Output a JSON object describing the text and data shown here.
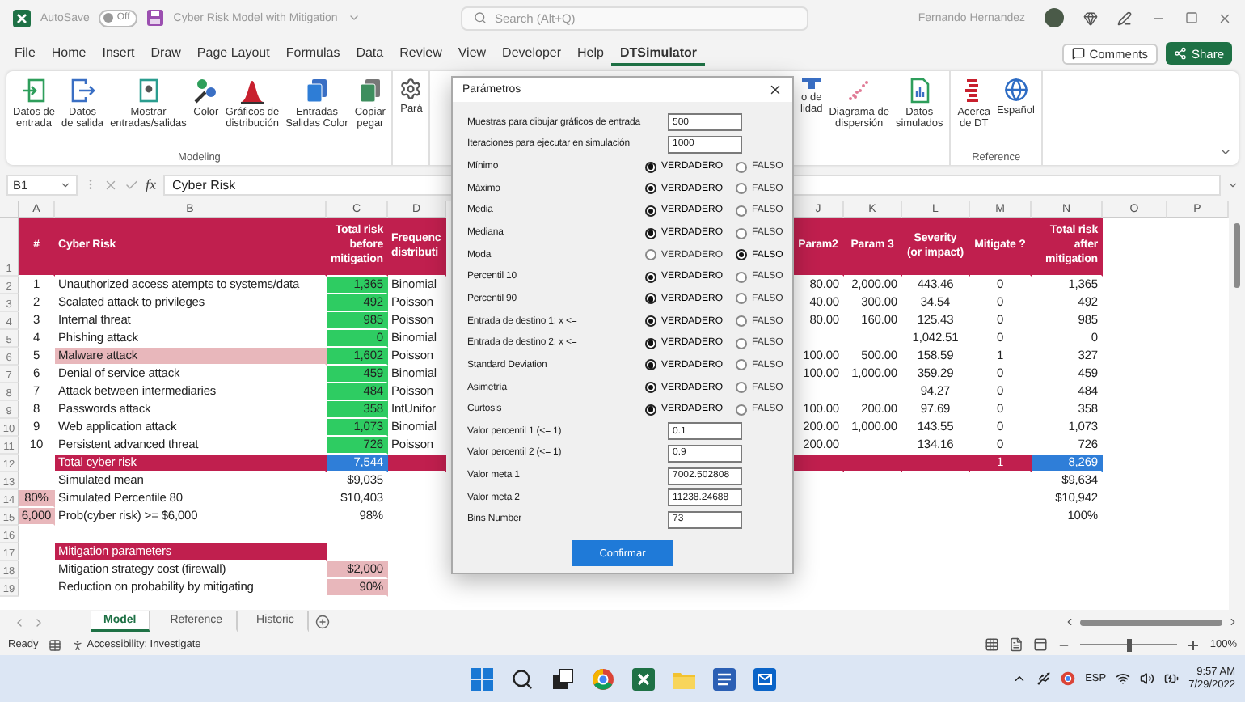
{
  "title_bar": {
    "autosave_label": "AutoSave",
    "autosave": {
      "on": false,
      "state_label": "Off"
    },
    "document_title": "Cyber Risk Model with Mitigation",
    "search": {
      "placeholder": "Search (Alt+Q)"
    },
    "user_name": "Fernando Hernandez"
  },
  "menu": {
    "tabs": [
      {
        "label": "File",
        "selected": false
      },
      {
        "label": "Home",
        "selected": false
      },
      {
        "label": "Insert",
        "selected": false
      },
      {
        "label": "Draw",
        "selected": false
      },
      {
        "label": "Page Layout",
        "selected": false
      },
      {
        "label": "Formulas",
        "selected": false
      },
      {
        "label": "Data",
        "selected": false
      },
      {
        "label": "Review",
        "selected": false
      },
      {
        "label": "View",
        "selected": false
      },
      {
        "label": "Developer",
        "selected": false
      },
      {
        "label": "Help",
        "selected": false
      },
      {
        "label": "DTSimulator",
        "selected": true
      }
    ],
    "comments_label": "Comments",
    "share_label": "Share"
  },
  "ribbon": {
    "left_groups": [
      {
        "label": "Modeling",
        "items": [
          "Datos de\nentrada",
          "Datos\nde salida",
          "Mostrar\nentradas/salidas",
          "Color",
          "Gráficos de\ndistribución",
          "Entradas\nSalidas Color",
          "Copiar\npegar"
        ]
      },
      {
        "items": [
          "Pará"
        ]
      }
    ],
    "right_groups": [
      {
        "items": [
          "o de\nlidad",
          "Diagrama de\ndispersión",
          "Datos\nsimulados"
        ]
      },
      {
        "label": "Reference",
        "items": [
          "Acerca\nde DT",
          "Español"
        ]
      }
    ]
  },
  "formula_bar": {
    "name_box": "B1",
    "function_label": "fx",
    "content": "Cyber Risk"
  },
  "sheet": {
    "left_columns": [
      "A",
      "B",
      "C",
      "D"
    ],
    "right_columns": [
      "J",
      "K",
      "L",
      "M",
      "N",
      "O",
      "P"
    ],
    "rows": [
      {
        "number": "1",
        "kind": "header",
        "cells": {
          "A": {
            "text": "#",
            "color": "#c01f4e"
          },
          "B": {
            "text": "Cyber Risk",
            "color": "#c01f4e"
          },
          "C": {
            "text": "Total risk before mitigation",
            "color": "#c01f4e"
          },
          "D": {
            "text": "Frequenc distributi",
            "color": "#c01f4e"
          },
          "J": {
            "text": "Param2",
            "color": "#c01f4e"
          },
          "K": {
            "text": "Param 3",
            "color": "#c01f4e"
          },
          "L": {
            "text": "Severity (or impact)",
            "color": "#c01f4e"
          },
          "M": {
            "text": "Mitigate ?",
            "color": "#c01f4e"
          },
          "N": {
            "text": "Total risk after mitigation",
            "color": "#c01f4e"
          }
        }
      },
      {
        "number": "2",
        "kind": "data",
        "cells": {
          "A": {
            "text": "1"
          },
          "B": {
            "text": "Unauthorized access atempts to systems/data"
          },
          "C": {
            "text": "1,365",
            "color": "#2ecc62"
          },
          "D": {
            "text": "Binomial"
          },
          "J": {
            "text": "80.00"
          },
          "K": {
            "text": "2,000.00"
          },
          "L": {
            "text": "443.46"
          },
          "M": {
            "text": "0"
          },
          "N": {
            "text": "1,365"
          }
        }
      },
      {
        "number": "3",
        "kind": "data",
        "cells": {
          "A": {
            "text": "2"
          },
          "B": {
            "text": "Scalated attack to privileges"
          },
          "C": {
            "text": "492",
            "color": "#2ecc62"
          },
          "D": {
            "text": "Poisson"
          },
          "J": {
            "text": "40.00"
          },
          "K": {
            "text": "300.00"
          },
          "L": {
            "text": "34.54"
          },
          "M": {
            "text": "0"
          },
          "N": {
            "text": "492"
          }
        }
      },
      {
        "number": "4",
        "kind": "data",
        "cells": {
          "A": {
            "text": "3"
          },
          "B": {
            "text": "Internal threat"
          },
          "C": {
            "text": "985",
            "color": "#2ecc62"
          },
          "D": {
            "text": "Poisson"
          },
          "J": {
            "text": "80.00"
          },
          "K": {
            "text": "160.00"
          },
          "L": {
            "text": "125.43"
          },
          "M": {
            "text": "0"
          },
          "N": {
            "text": "985"
          }
        }
      },
      {
        "number": "5",
        "kind": "data",
        "cells": {
          "A": {
            "text": "4"
          },
          "B": {
            "text": "Phishing attack"
          },
          "C": {
            "text": "0",
            "color": "#2ecc62"
          },
          "D": {
            "text": "Binomial"
          },
          "L": {
            "text": "1,042.51"
          },
          "M": {
            "text": "0"
          },
          "N": {
            "text": "0"
          }
        }
      },
      {
        "number": "6",
        "kind": "data",
        "cells": {
          "A": {
            "text": "5"
          },
          "B": {
            "text": "Malware attack",
            "color": "#e8b7bb"
          },
          "C": {
            "text": "1,602",
            "color": "#2ecc62"
          },
          "D": {
            "text": "Poisson"
          },
          "J": {
            "text": "100.00"
          },
          "K": {
            "text": "500.00"
          },
          "L": {
            "text": "158.59"
          },
          "M": {
            "text": "1"
          },
          "N": {
            "text": "327"
          }
        }
      },
      {
        "number": "7",
        "kind": "data",
        "cells": {
          "A": {
            "text": "6"
          },
          "B": {
            "text": "Denial of service attack"
          },
          "C": {
            "text": "459",
            "color": "#2ecc62"
          },
          "D": {
            "text": "Binomial"
          },
          "J": {
            "text": "100.00"
          },
          "K": {
            "text": "1,000.00"
          },
          "L": {
            "text": "359.29"
          },
          "M": {
            "text": "0"
          },
          "N": {
            "text": "459"
          }
        }
      },
      {
        "number": "8",
        "kind": "data",
        "cells": {
          "A": {
            "text": "7"
          },
          "B": {
            "text": "Attack between intermediaries"
          },
          "C": {
            "text": "484",
            "color": "#2ecc62"
          },
          "D": {
            "text": "Poisson"
          },
          "L": {
            "text": "94.27"
          },
          "M": {
            "text": "0"
          },
          "N": {
            "text": "484"
          }
        }
      },
      {
        "number": "9",
        "kind": "data",
        "cells": {
          "A": {
            "text": "8"
          },
          "B": {
            "text": "Passwords attack"
          },
          "C": {
            "text": "358",
            "color": "#2ecc62"
          },
          "D": {
            "text": "IntUnifor"
          },
          "J": {
            "text": "100.00"
          },
          "K": {
            "text": "200.00"
          },
          "L": {
            "text": "97.69"
          },
          "M": {
            "text": "0"
          },
          "N": {
            "text": "358"
          }
        }
      },
      {
        "number": "10",
        "kind": "data",
        "cells": {
          "A": {
            "text": "9"
          },
          "B": {
            "text": "Web application attack"
          },
          "C": {
            "text": "1,073",
            "color": "#2ecc62"
          },
          "D": {
            "text": "Binomial"
          },
          "J": {
            "text": "200.00"
          },
          "K": {
            "text": "1,000.00"
          },
          "L": {
            "text": "143.55"
          },
          "M": {
            "text": "0"
          },
          "N": {
            "text": "1,073"
          }
        }
      },
      {
        "number": "11",
        "kind": "data",
        "cells": {
          "A": {
            "text": "10"
          },
          "B": {
            "text": "Persistent advanced threat"
          },
          "C": {
            "text": "726",
            "color": "#2ecc62"
          },
          "D": {
            "text": "Poisson"
          },
          "J": {
            "text": "200.00"
          },
          "L": {
            "text": "134.16"
          },
          "M": {
            "text": "0"
          },
          "N": {
            "text": "726"
          }
        }
      },
      {
        "number": "12",
        "kind": "data",
        "cells": {
          "B": {
            "text": "Total cyber risk",
            "color": "#c01f4e"
          },
          "C": {
            "text": "7,544",
            "color": "#2f7ed8"
          },
          "D": {
            "color": "#c01f4e"
          },
          "J": {
            "color": "#c01f4e"
          },
          "K": {
            "color": "#c01f4e"
          },
          "L": {
            "color": "#c01f4e"
          },
          "M": {
            "text": "1",
            "color": "#c01f4e"
          },
          "N": {
            "text": "8,269",
            "color": "#2f7ed8"
          }
        }
      },
      {
        "number": "13",
        "kind": "data",
        "cells": {
          "B": {
            "text": "Simulated mean"
          },
          "C": {
            "text": "$9,035"
          },
          "N": {
            "text": "$9,634"
          }
        }
      },
      {
        "number": "14",
        "kind": "data",
        "cells": {
          "A": {
            "text": "80%",
            "color": "#e8b7bb"
          },
          "B": {
            "text": "Simulated Percentile 80"
          },
          "C": {
            "text": "$10,403"
          },
          "N": {
            "text": "$10,942"
          }
        }
      },
      {
        "number": "15",
        "kind": "data",
        "cells": {
          "A": {
            "text": "6,000",
            "color": "#e8b7bb"
          },
          "B": {
            "text": "Prob(cyber risk) >= $6,000"
          },
          "C": {
            "text": "98%"
          },
          "N": {
            "text": "100%"
          }
        }
      },
      {
        "number": "16",
        "kind": "data"
      },
      {
        "number": "17",
        "kind": "data",
        "cells": {
          "B": {
            "text": "Mitigation parameters",
            "color": "#c01f4e"
          }
        }
      },
      {
        "number": "18",
        "kind": "data",
        "cells": {
          "B": {
            "text": "Mitigation strategy cost (firewall)"
          },
          "C": {
            "text": "$2,000",
            "color": "#e8b7bb"
          }
        }
      },
      {
        "number": "19",
        "kind": "data",
        "cells": {
          "B": {
            "text": "Reduction on probability by mitigating"
          },
          "C": {
            "text": "90%",
            "color": "#e8b7bb"
          }
        }
      }
    ]
  },
  "dialog": {
    "title": "Parámetros",
    "rows": [
      {
        "kind": "field",
        "label": "Muestras para dibujar gráficos de entrada",
        "value": "500"
      },
      {
        "kind": "field",
        "label": "Iteraciones para ejecutar en simulación",
        "value": "1000"
      },
      {
        "kind": "radio",
        "label": "Mínimo",
        "options": [
          {
            "label": "VERDADERO",
            "selected": true
          },
          {
            "label": "FALSO",
            "selected": false
          }
        ]
      },
      {
        "kind": "radio",
        "label": "Máximo",
        "options": [
          {
            "label": "VERDADERO",
            "selected": true
          },
          {
            "label": "FALSO",
            "selected": false
          }
        ]
      },
      {
        "kind": "radio",
        "label": "Media",
        "options": [
          {
            "label": "VERDADERO",
            "selected": true
          },
          {
            "label": "FALSO",
            "selected": false
          }
        ]
      },
      {
        "kind": "radio",
        "label": "Mediana",
        "options": [
          {
            "label": "VERDADERO",
            "selected": true
          },
          {
            "label": "FALSO",
            "selected": false
          }
        ]
      },
      {
        "kind": "radio",
        "label": "Moda",
        "options": [
          {
            "label": "VERDADERO",
            "selected": false
          },
          {
            "label": "FALSO",
            "selected": true
          }
        ]
      },
      {
        "kind": "radio",
        "label": "Percentil 10",
        "options": [
          {
            "label": "VERDADERO",
            "selected": true
          },
          {
            "label": "FALSO",
            "selected": false
          }
        ]
      },
      {
        "kind": "radio",
        "label": "Percentil 90",
        "options": [
          {
            "label": "VERDADERO",
            "selected": true
          },
          {
            "label": "FALSO",
            "selected": false
          }
        ]
      },
      {
        "kind": "radio",
        "label": "Entrada de destino 1: x <=",
        "options": [
          {
            "label": "VERDADERO",
            "selected": true
          },
          {
            "label": "FALSO",
            "selected": false
          }
        ]
      },
      {
        "kind": "radio",
        "label": "Entrada de destino 2: x <=",
        "options": [
          {
            "label": "VERDADERO",
            "selected": true
          },
          {
            "label": "FALSO",
            "selected": false
          }
        ]
      },
      {
        "kind": "radio",
        "label": "Standard Deviation",
        "options": [
          {
            "label": "VERDADERO",
            "selected": true
          },
          {
            "label": "FALSO",
            "selected": false
          }
        ]
      },
      {
        "kind": "radio",
        "label": "Asimetría",
        "options": [
          {
            "label": "VERDADERO",
            "selected": true
          },
          {
            "label": "FALSO",
            "selected": false
          }
        ]
      },
      {
        "kind": "radio",
        "label": "Curtosis",
        "options": [
          {
            "label": "VERDADERO",
            "selected": true
          },
          {
            "label": "FALSO",
            "selected": false
          }
        ]
      },
      {
        "kind": "field",
        "label": "Valor percentil 1 (<= 1)",
        "value": "0.1"
      },
      {
        "kind": "field",
        "label": "Valor percentil 2 (<= 1)",
        "value": "0.9"
      },
      {
        "kind": "field",
        "label": "Valor meta 1",
        "value": "7002.502808"
      },
      {
        "kind": "field",
        "label": "Valor meta 2",
        "value": "11238.24688"
      },
      {
        "kind": "field",
        "label": "Bins Number",
        "value": "73"
      }
    ],
    "button": "Confirmar"
  },
  "sheet_tabs": [
    {
      "label": "Model",
      "selected": true
    },
    {
      "label": "Reference",
      "selected": false
    },
    {
      "label": "Historic",
      "selected": false
    }
  ],
  "status_bar": {
    "status": "Ready",
    "accessibility": "Accessibility: Investigate",
    "zoom": {
      "level": 0.5,
      "reading": "100%"
    }
  },
  "taskbar": {
    "language": "ESP",
    "time": "9:57 AM",
    "date": "7/29/2022"
  }
}
